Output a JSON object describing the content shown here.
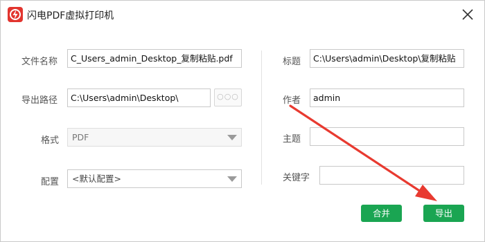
{
  "window": {
    "title": "闪电PDF虚拟打印机"
  },
  "form_left": {
    "file_name": {
      "label": "文件名称",
      "value": "C_Users_admin_Desktop_复制粘贴.pdf"
    },
    "export_path": {
      "label": "导出路径",
      "value": "C:\\Users\\admin\\Desktop\\",
      "browse_label": "○○○"
    },
    "format": {
      "label": "格式",
      "value": "PDF"
    },
    "config": {
      "label": "配置",
      "value": "<默认配置>"
    }
  },
  "form_right": {
    "title_field": {
      "label": "标题",
      "value": "C:\\Users\\admin\\Desktop\\复制粘贴"
    },
    "author": {
      "label": "作者",
      "value": "admin"
    },
    "subject": {
      "label": "主题",
      "value": ""
    },
    "keywords": {
      "label": "关键字",
      "value": ""
    }
  },
  "buttons": {
    "merge": "合并",
    "export": "导出"
  },
  "colors": {
    "accent_green": "#1aa552",
    "annotation_red": "#e83a30",
    "logo_red": "#e2352f"
  }
}
